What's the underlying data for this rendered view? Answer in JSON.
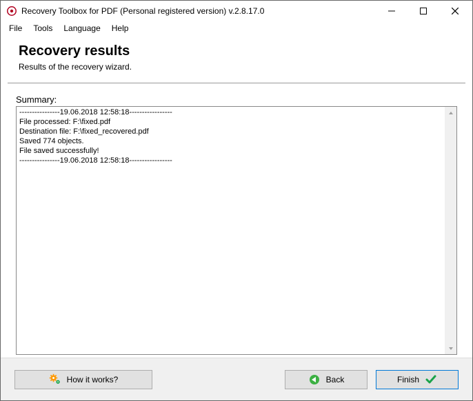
{
  "window": {
    "title": "Recovery Toolbox for PDF (Personal registered version) v.2.8.17.0"
  },
  "menu": {
    "file": "File",
    "tools": "Tools",
    "language": "Language",
    "help": "Help"
  },
  "header": {
    "title": "Recovery results",
    "subtitle": "Results of the recovery wizard."
  },
  "summary": {
    "label": "Summary:",
    "log": "----------------19.06.2018 12:58:18-----------------\nFile processed: F:\\fixed.pdf\nDestination file: F:\\fixed_recovered.pdf\nSaved 774 objects.\nFile saved successfully!\n----------------19.06.2018 12:58:18-----------------"
  },
  "footer": {
    "how_it_works": "How it works?",
    "back": "Back",
    "finish": "Finish"
  }
}
